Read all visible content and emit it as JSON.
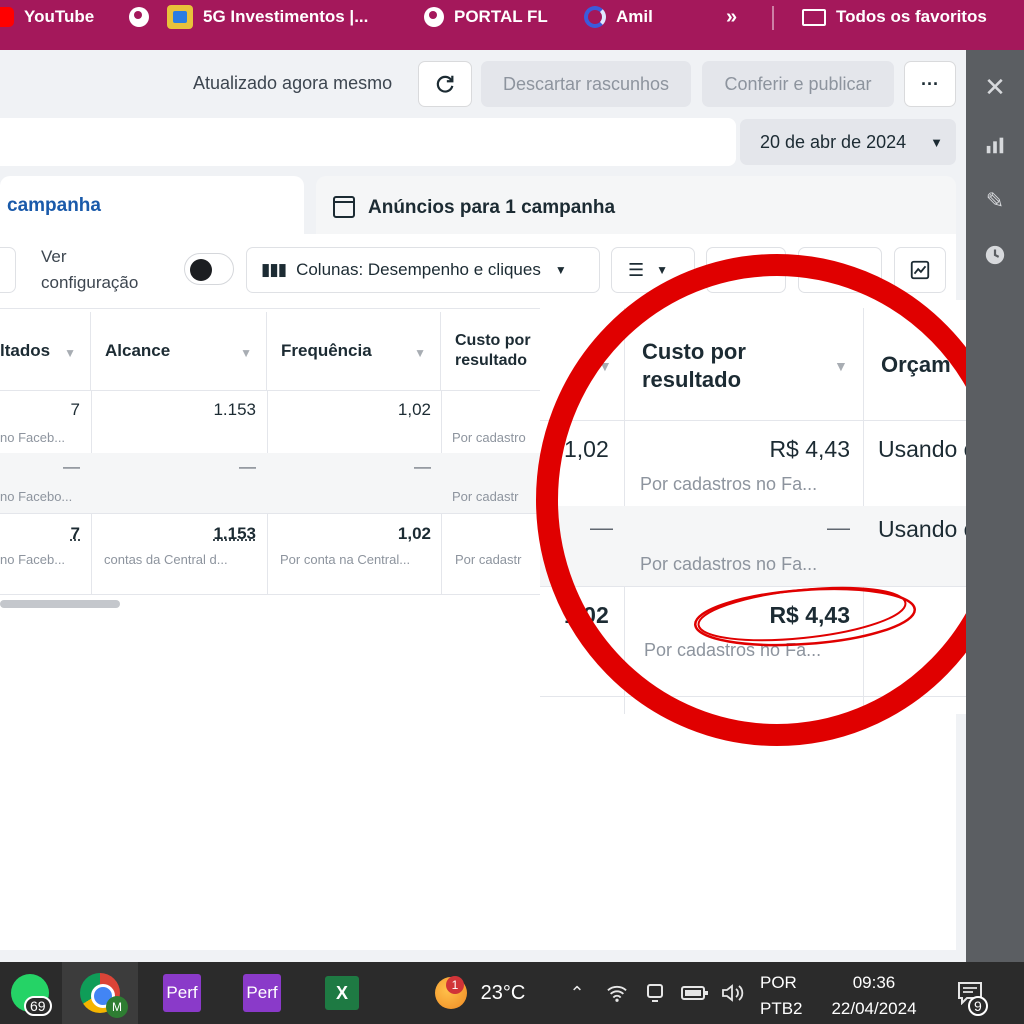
{
  "bookmarks": {
    "items": [
      {
        "label": "YouTube",
        "icon": "youtube-icon"
      },
      {
        "label": "5G Investimentos |...",
        "icon": "globe-icon"
      },
      {
        "label": "PORTAL FL",
        "icon": "globe-icon"
      },
      {
        "label": "Amil",
        "icon": "amil-icon"
      }
    ],
    "more": "»",
    "all_label": "Todos os favoritos"
  },
  "topbar": {
    "status": "Atualizado agora mesmo",
    "discard_label": "Descartar rascunhos",
    "publish_label": "Conferir e publicar",
    "more_label": "···"
  },
  "date_range": {
    "label": "20 de abr de 2024"
  },
  "tabs": [
    {
      "label": "campanha",
      "active": true
    },
    {
      "label": "Anúncios para 1 campanha",
      "active": false
    }
  ],
  "toolbar": {
    "view_config": "Ver\nconfiguração",
    "columns_label": "Colunas: Desempenho e cliques"
  },
  "table": {
    "headers": [
      "ltados",
      "Alcance",
      "Frequência",
      "Custo por resultado"
    ],
    "rows": [
      {
        "results": "7",
        "results_sub": "no Faceb...",
        "reach": "1.153",
        "frequency": "1,02",
        "cost_sub": "Por cadastro"
      },
      {
        "results": "—",
        "results_sub": "no Facebo...",
        "reach": "—",
        "frequency": "—",
        "cost_sub": "Por cadastr"
      },
      {
        "results": "7",
        "results_sub": "no Faceb...",
        "reach": "1.153",
        "reach_sub": "contas da Central d...",
        "frequency": "1,02",
        "frequency_sub": "Por conta na Central...",
        "cost_sub": "Por cadastr"
      }
    ]
  },
  "zoom": {
    "header_cost": "Custo por\nresultado",
    "header_budget": "Orçam",
    "rows": [
      {
        "freq": "1,02",
        "cost": "R$ 4,43",
        "cost_sub": "Por cadastros no Fa...",
        "budget": "Usando or"
      },
      {
        "freq": "—",
        "cost": "—",
        "cost_sub": "Por cadastros no Fa...",
        "budget": "Usando or"
      },
      {
        "freq": "1,02",
        "cost": "R$ 4,43",
        "cost_sub": "Por cadastros no Fa...",
        "budget": ""
      }
    ],
    "highlight_color": "#e00000"
  },
  "taskbar": {
    "whatsapp_badge": "69",
    "chrome_profile": "M",
    "app1": "Perf",
    "app2": "Perf",
    "excel": "X",
    "weather_badge": "1",
    "temperature": "23°C",
    "lang_top": "POR",
    "lang_bottom": "PTB2",
    "time": "09:36",
    "date": "22/04/2024",
    "notifications": "9"
  }
}
